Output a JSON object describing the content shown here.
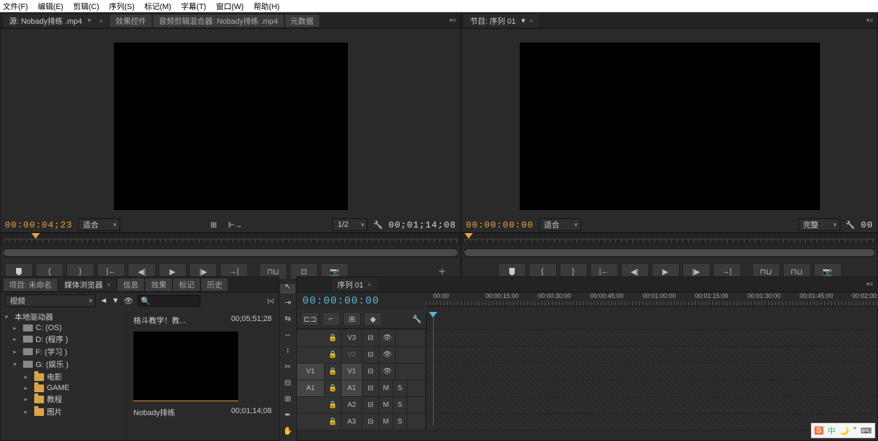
{
  "menu": {
    "file": "文件(F)",
    "edit": "编辑(E)",
    "clip": "剪辑(C)",
    "sequence": "序列(S)",
    "marker": "标记(M)",
    "title": "字幕(T)",
    "window": "窗口(W)",
    "help": "帮助(H)"
  },
  "source_panel": {
    "tabs": {
      "source": "源: Nobady排练 .mp4",
      "effects": "效果控件",
      "mixer": "音频剪辑混合器: Nobady排练 .mp4",
      "metadata": "元数据"
    },
    "tc_in": "00:00:04;23",
    "fit": "适合",
    "res": "1/2",
    "tc_out": "00;01;14;08"
  },
  "program_panel": {
    "tab": "节目: 序列 01",
    "tc_in": "00:00:00:00",
    "fit": "适合",
    "quality": "完整",
    "tc_out": "00"
  },
  "project": {
    "tab_project": "项目: 未命名",
    "tab_media": "媒体浏览器",
    "tab_info": "信息",
    "tab_effects": "效果",
    "tab_markers": "标记",
    "tab_history": "历史",
    "filter": "视频",
    "root": "本地驱动器",
    "drives": {
      "c": "C: (OS)",
      "d": "D: (程序 )",
      "f": "F: (学习 )",
      "g": "G: (娱乐 )"
    },
    "folders": {
      "movie": "电影",
      "game": "GAME",
      "tutorial": "教程",
      "picture": "图片"
    },
    "thumb_title": "格斗教学！教...",
    "thumb_dur": "00;05;51;28",
    "clip_name": "Nobady排练",
    "clip_dur": "00;01;14;08"
  },
  "timeline": {
    "tab": "序列 01",
    "tc": "00:00:00:00",
    "ticks": [
      "00:00",
      "00:00:15:00",
      "00:00:30:00",
      "00:00:45:00",
      "00:01:00:00",
      "00:01:15:00",
      "00:01:30:00",
      "00:01:45:00",
      "00:02:00:"
    ],
    "tracks": {
      "v3": "V3",
      "v2": "V2",
      "v1": "V1",
      "a1": "A1",
      "a2": "A2",
      "a3": "A3"
    },
    "src": {
      "v1": "V1",
      "a1": "A1"
    },
    "btns": {
      "m": "M",
      "s": "S"
    }
  },
  "icons": {
    "lock": "🔒",
    "eye": "👁",
    "snap": "⌐",
    "link": "🔗",
    "marker": "❏",
    "wrench": "🔧",
    "camera": "📷",
    "plus": "+"
  },
  "ime": {
    "s": "S",
    "zhong": "中",
    "moon": "🌙",
    "dot": "°",
    "kb": "⌨"
  }
}
